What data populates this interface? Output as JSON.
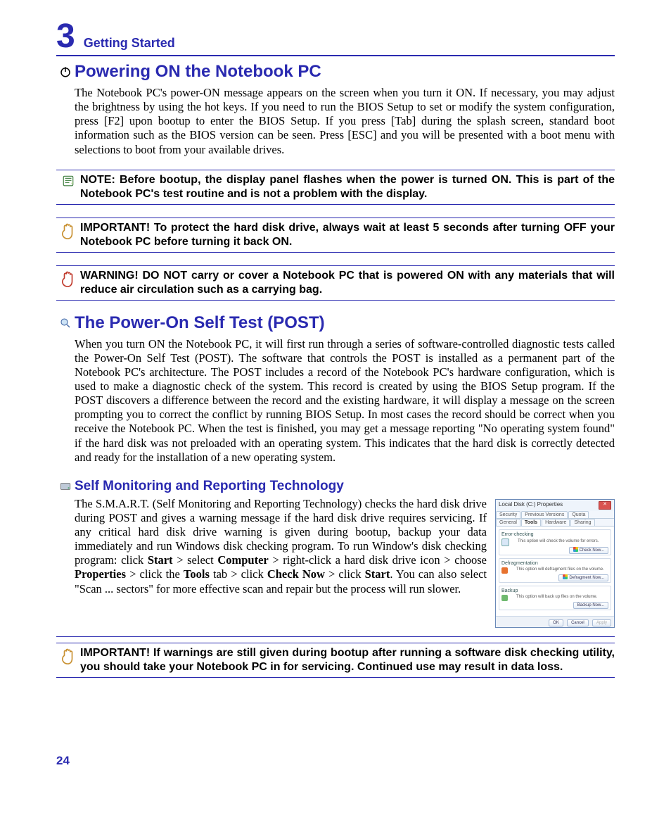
{
  "chapter": {
    "number": "3",
    "title": "Getting Started"
  },
  "section1": {
    "title": "Powering ON the Notebook PC",
    "body": "The Notebook PC's power-ON message appears on the screen when you turn it ON. If necessary, you may adjust the brightness by using the hot keys. If you need to run the BIOS Setup to set or modify the system configuration, press [F2] upon bootup to enter the BIOS Setup. If you press [Tab] during the splash screen, standard boot information such as the BIOS version can be seen. Press [ESC] and you will be presented with a boot menu with selections to boot from your available drives."
  },
  "note": {
    "text": "NOTE:  Before bootup, the display panel flashes when the power is turned ON. This is part of the Notebook PC's test routine and is not a problem with the display."
  },
  "important1": {
    "text": "IMPORTANT!  To protect the hard disk drive, always wait at least 5 seconds after turning OFF your Notebook PC before turning it back ON."
  },
  "warning": {
    "text": "WARNING! DO NOT carry or cover a Notebook PC that is powered ON with any materials that will reduce air circulation such as a carrying bag."
  },
  "section2": {
    "title": "The Power-On Self Test (POST)",
    "body": "When you turn ON the Notebook PC, it will first run through a series of software-controlled diagnostic tests called the Power-On Self Test (POST). The software that controls the POST is installed as a permanent part of the Notebook PC's architecture. The POST includes a record of the Notebook PC's hardware configuration, which is used to make a diagnostic check of the system. This record is created by using the BIOS Setup program. If the POST discovers a difference between the record and the existing hardware, it will display a message on the screen prompting you to correct the conflict by running BIOS Setup. In most cases the record should be correct when you receive the Notebook PC. When the test is finished, you may get a message reporting \"No operating system found\" if the hard disk was not preloaded with an operating system. This indicates that the hard disk is correctly detected and ready for the installation of a new operating system."
  },
  "smart": {
    "title": "Self Monitoring and Reporting Technology",
    "intro": "The S.M.A.R.T. (Self Monitoring and Reporting Technology) checks the hard disk drive during POST and gives a warning message if the hard disk drive requires servicing. If any critical hard disk drive warning is given during bootup, backup your data immediately and run Windows disk checking program. To run Window's disk checking program: click ",
    "b1": "Start",
    "t1": " > select ",
    "b2": "Computer",
    "t2": " > right-click a hard disk drive icon > choose ",
    "b3": "Properties",
    "t3": " > click the ",
    "b4": "Tools",
    "t4": " tab > click ",
    "b5": "Check Now",
    "t5": " > click ",
    "b6": "Start",
    "t6": ". You can also select \"Scan ... sectors\" for more effective scan and repair but the process will run slower."
  },
  "dialog": {
    "title": "Local Disk (C:) Properties",
    "tabs_top": [
      "Security",
      "Previous Versions",
      "Quota"
    ],
    "tabs_bottom": [
      "General",
      "Tools",
      "Hardware",
      "Sharing"
    ],
    "group1": {
      "title": "Error-checking",
      "desc": "This option will check the volume for errors.",
      "button": "Check Now..."
    },
    "group2": {
      "title": "Defragmentation",
      "desc": "This option will defragment files on the volume.",
      "button": "Defragment Now..."
    },
    "group3": {
      "title": "Backup",
      "desc": "This option will back up files on the volume.",
      "button": "Backup Now..."
    },
    "foot": {
      "ok": "OK",
      "cancel": "Cancel",
      "apply": "Apply"
    }
  },
  "important2": {
    "text": "IMPORTANT! If warnings are still given during bootup after running a software disk checking utility, you should take your Notebook PC in for servicing. Continued use may result in data loss."
  },
  "page_number": "24"
}
